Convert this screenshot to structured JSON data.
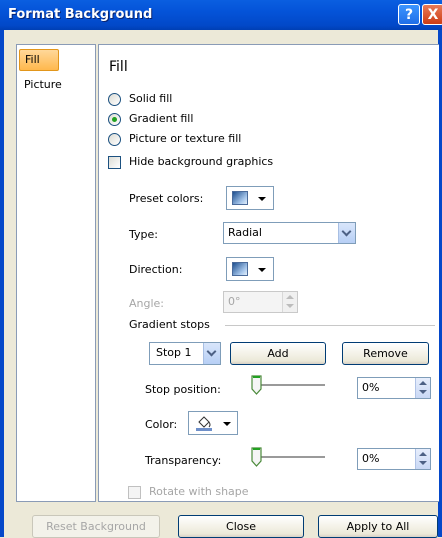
{
  "window": {
    "title": "Format Background"
  },
  "title_buttons": {
    "help": "?",
    "close": "X"
  },
  "nav": {
    "items": [
      {
        "label": "Fill",
        "selected": true
      },
      {
        "label": "Picture",
        "selected": false
      }
    ]
  },
  "panel": {
    "heading": "Fill",
    "options": {
      "solid": "Solid fill",
      "gradient": "Gradient fill",
      "picture_texture": "Picture or texture fill",
      "selected": "gradient"
    },
    "hide_background_graphics": {
      "label": "Hide background graphics",
      "checked": false
    },
    "preset_colors_label": "Preset colors:",
    "type_label": "Type:",
    "type_value": "Radial",
    "direction_label": "Direction:",
    "angle_label": "Angle:",
    "angle_value": "0°",
    "gradient_stops": {
      "heading": "Gradient stops",
      "stop_value": "Stop 1",
      "add_label": "Add",
      "remove_label": "Remove",
      "stop_position_label": "Stop position:",
      "stop_position_value": "0%",
      "color_label": "Color:",
      "transparency_label": "Transparency:",
      "transparency_value": "0%"
    },
    "rotate_with_shape": {
      "label": "Rotate with shape",
      "checked": false,
      "enabled": false
    }
  },
  "footer": {
    "reset_label": "Reset Background",
    "close_label": "Close",
    "apply_all_label": "Apply to All"
  },
  "colors": {
    "titlebar": "#0453d8",
    "selection": "#ffb84d",
    "radio_dot": "#21a121"
  }
}
